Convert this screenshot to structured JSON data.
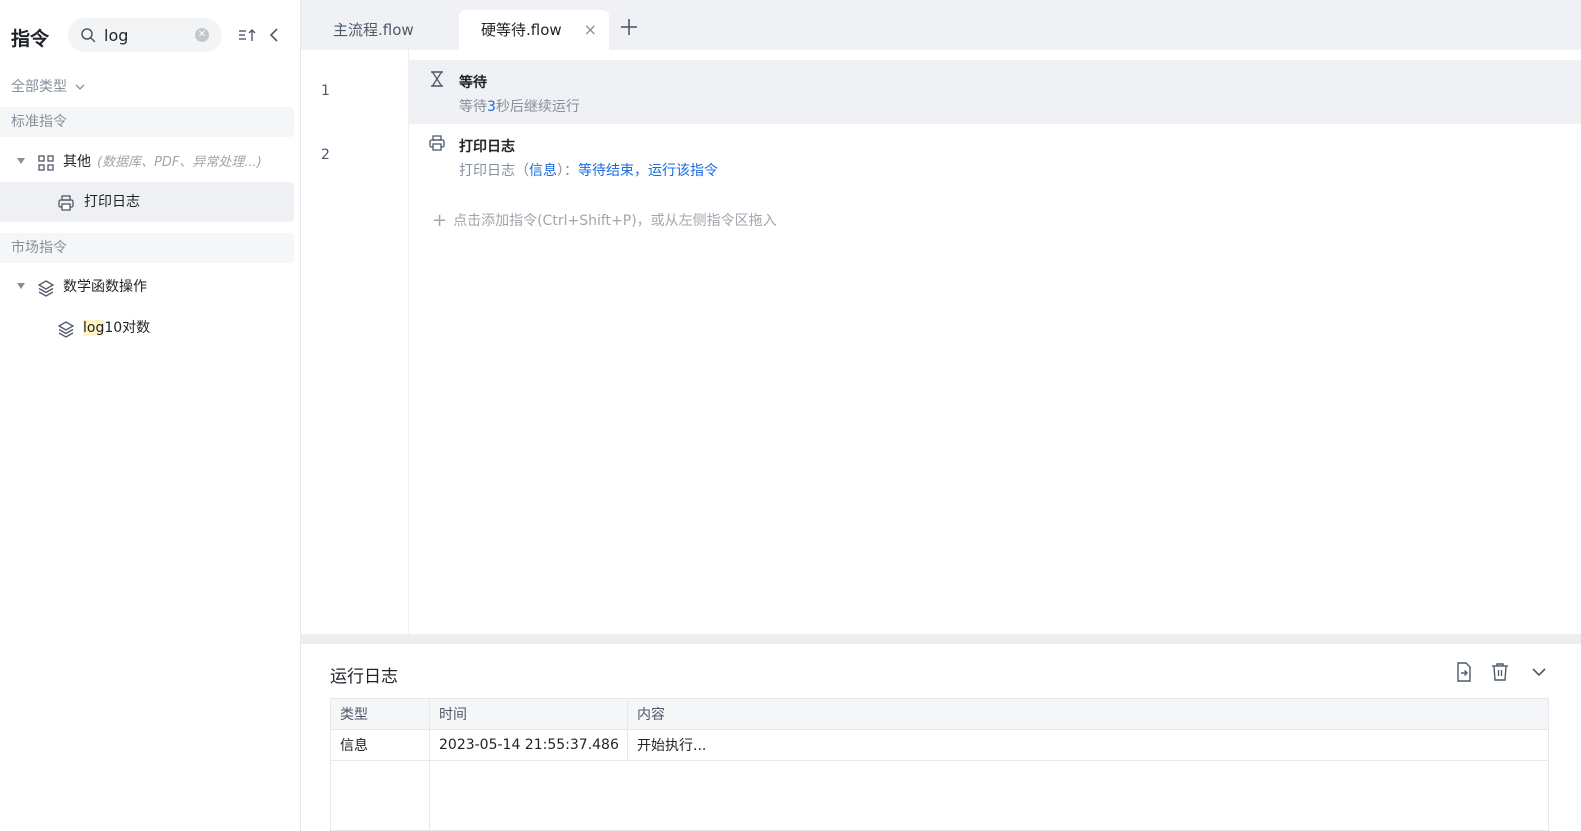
{
  "sidebar": {
    "title": "指令",
    "search": {
      "value": "log",
      "placeholder": ""
    },
    "type_filter": "全部类型",
    "sections": [
      {
        "label": "标准指令",
        "group": {
          "label": "其他",
          "hint": "(数据库、PDF、异常处理...)",
          "icon": "grid-icon"
        },
        "item": {
          "label": "打印日志",
          "icon": "printer-icon"
        }
      },
      {
        "label": "市场指令",
        "group": {
          "label": "数学函数操作",
          "icon": "layers-icon"
        },
        "item": {
          "label_highlight": "log",
          "label_rest": "10对数",
          "icon": "layers-icon"
        }
      }
    ]
  },
  "tabs": [
    {
      "label": "主流程.flow",
      "active": false
    },
    {
      "label": "硬等待.flow",
      "active": true,
      "close": "×"
    }
  ],
  "editor": {
    "lines": [
      {
        "no": "1",
        "icon": "hourglass-icon",
        "title": "等待",
        "desc_pre": "等待",
        "desc_value": "3",
        "desc_post": "秒后继续运行"
      },
      {
        "no": "2",
        "icon": "printer-icon",
        "title": "打印日志",
        "desc_pre": "打印日志（",
        "desc_level": "信息",
        "desc_mid": "）：",
        "desc_message": "等待结束，运行该指令"
      }
    ],
    "add_hint": "点击添加指令(Ctrl+Shift+P)，或从左侧指令区拖入"
  },
  "log": {
    "title": "运行日志",
    "columns": [
      "类型",
      "时间",
      "内容"
    ],
    "rows": [
      {
        "type": "信息",
        "time": "2023-05-14 21:55:37.486",
        "content": "开始执行..."
      }
    ]
  },
  "colors": {
    "accent": "#1b6ce0",
    "highlight": "#fff3c4"
  }
}
